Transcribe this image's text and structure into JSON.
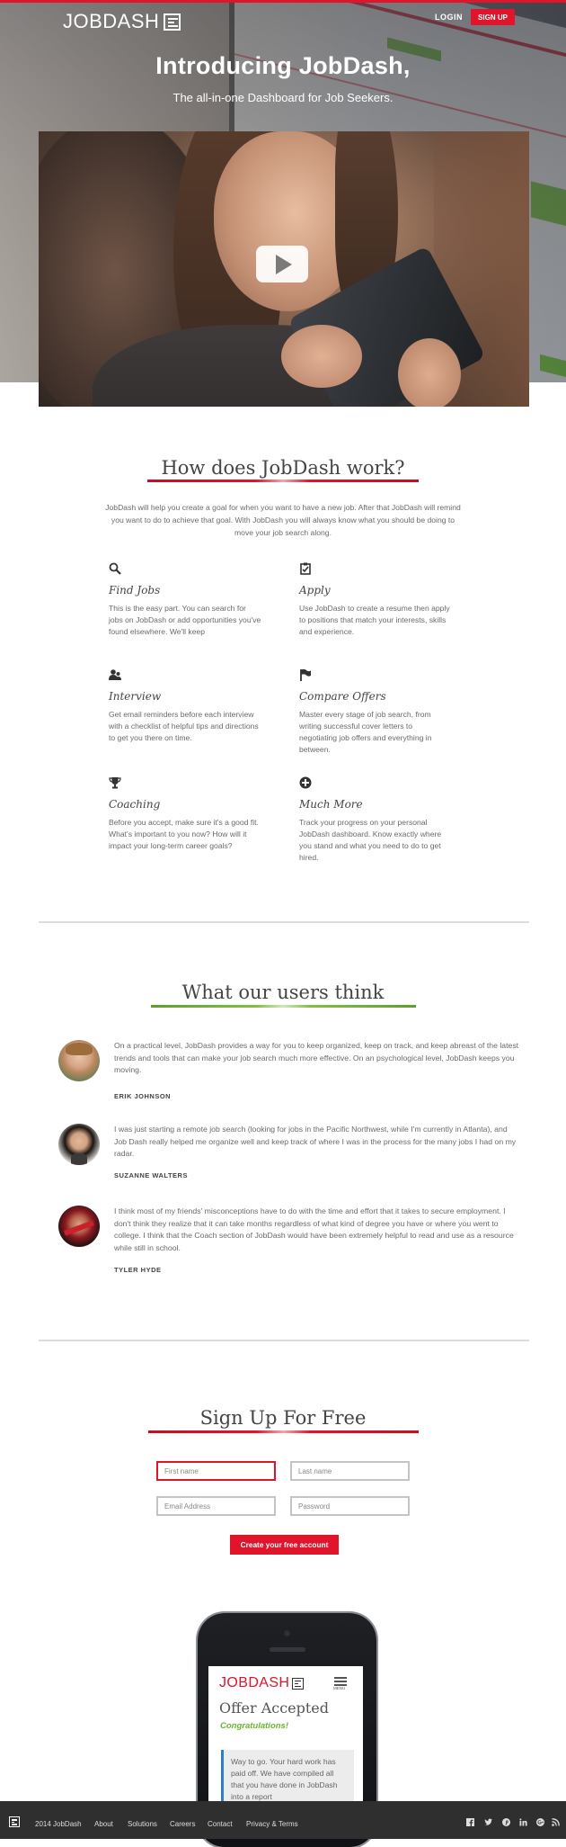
{
  "brand": {
    "logo_text": "JOBDASH",
    "accent_red": "#e0142a",
    "accent_green": "#6ab630",
    "footer_bg": "#2f2f2f"
  },
  "nav": {
    "login": "LOGIN",
    "signup": "SIGN UP"
  },
  "hero": {
    "title": "Introducing JobDash,",
    "subtitle": "The all-in-one Dashboard for Job Seekers.",
    "video_icon": "play-icon"
  },
  "how": {
    "title": "How does JobDash work?",
    "intro": "JobDash will help you create a goal for when you want to have a new job. After that JobDash will remind you want to do to achieve that goal. With JobDash you will always know what you should be doing to move your job search along.",
    "features": [
      {
        "icon": "search-icon",
        "title": "Find Jobs",
        "text": "This is the easy part. You can search for jobs on JobDash or add opportunities you've found elsewhere. We'll keep"
      },
      {
        "icon": "clipboard-check-icon",
        "title": "Apply",
        "text": "Use JobDash to create a resume then apply to positions that match your interests, skills and experience."
      },
      {
        "icon": "interview-icon",
        "title": "Interview",
        "text": "Get email reminders before each interview with a checklist of helpful tips and directions to get you there on time."
      },
      {
        "icon": "flag-icon",
        "title": "Compare Offers",
        "text": "Master every stage of job search, from writing successful cover letters to negotiating job offers and everything in between."
      },
      {
        "icon": "trophy-icon",
        "title": "Coaching",
        "text": "Before you accept, make sure it's a good fit. What's important to you now? How will it impact your long-term career goals?"
      },
      {
        "icon": "plus-circle-icon",
        "title": "Much More",
        "text": "Track your progress on your personal JobDash dashboard. Know exactly where you stand and what you need to do to get hired."
      }
    ]
  },
  "users": {
    "title": "What our users think",
    "testimonials": [
      {
        "quote": "On a practical level, JobDash provides a way for you to keep organized, keep on track, and keep abreast of the latest trends and tools that can make your job search much more effective. On an psychological level, JobDash keeps you moving.",
        "name": "ERIK JOHNSON"
      },
      {
        "quote": "I was just starting a remote job search (looking for jobs in the Pacific Northwest, while I'm currently in Atlanta), and Job Dash really helped me organize well and keep track of where I was in the process for the many jobs I had on my radar.",
        "name": "SUZANNE WALTERS"
      },
      {
        "quote": "I think most of my friends' misconceptions have to do with the time and effort that it takes to secure employment. I don't think they realize that it can take months regardless of what kind of degree you have or where you went to college. I think that the Coach section of JobDash would have been extremely helpful to read and use as a resource while still in school.",
        "name": "TYLER HYDE"
      }
    ]
  },
  "signup": {
    "title": "Sign Up For Free",
    "first_name_placeholder": "First name",
    "last_name_placeholder": "Last name",
    "email_placeholder": "Email Address",
    "password_placeholder": "Password",
    "submit": "Create your free account"
  },
  "phone_preview": {
    "logo_job": "JOB",
    "logo_dash": "DASH",
    "menu_label": "MENU",
    "title": "Offer Accepted",
    "congrats": "Congratulations!",
    "quote": "Way to go. Your hard work has paid off. We have compiled all that you have done in JobDash into a report"
  },
  "footer": {
    "links": [
      "2014 JobDash",
      "About",
      "Solutions",
      "Careers",
      "Contact",
      "Privacy & Terms"
    ],
    "social": [
      "facebook-icon",
      "twitter-icon",
      "pinterest-icon",
      "linkedin-icon",
      "google-plus-icon",
      "rss-icon"
    ]
  }
}
